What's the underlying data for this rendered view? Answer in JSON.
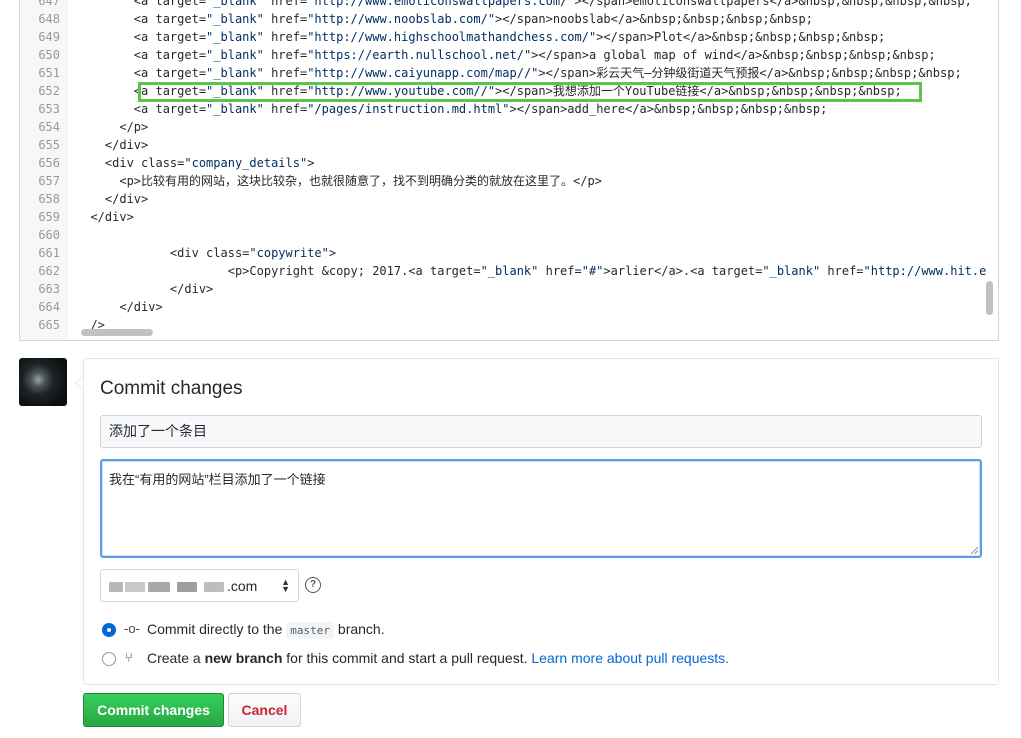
{
  "editor": {
    "lines": [
      {
        "n": "647",
        "parts": [
          {
            "t": "        <a target="
          },
          {
            "t": "\"_blank\"",
            "s": 1
          },
          {
            "t": " href="
          },
          {
            "t": "\"http://www.emoticonswallpapers.com/\"",
            "s": 1
          },
          {
            "t": "></span>emoticonswallpapers</a>&nbsp;&nbsp;&nbsp;&nbsp;"
          }
        ]
      },
      {
        "n": "648",
        "parts": [
          {
            "t": "        <a target="
          },
          {
            "t": "\"_blank\"",
            "s": 1
          },
          {
            "t": " href="
          },
          {
            "t": "\"http://www.noobslab.com/\"",
            "s": 1
          },
          {
            "t": "></span>noobslab</a>&nbsp;&nbsp;&nbsp;&nbsp;"
          }
        ]
      },
      {
        "n": "649",
        "parts": [
          {
            "t": "        <a target="
          },
          {
            "t": "\"_blank\"",
            "s": 1
          },
          {
            "t": " href="
          },
          {
            "t": "\"http://www.highschoolmathandchess.com/\"",
            "s": 1
          },
          {
            "t": "></span>Plot</a>&nbsp;&nbsp;&nbsp;&nbsp;"
          }
        ]
      },
      {
        "n": "650",
        "parts": [
          {
            "t": "        <a target="
          },
          {
            "t": "\"_blank\"",
            "s": 1
          },
          {
            "t": " href="
          },
          {
            "t": "\"https://earth.nullschool.net/\"",
            "s": 1
          },
          {
            "t": "></span>a global map of wind</a>&nbsp;&nbsp;&nbsp;&nbsp;"
          }
        ]
      },
      {
        "n": "651",
        "parts": [
          {
            "t": "        <a target="
          },
          {
            "t": "\"_blank\"",
            "s": 1
          },
          {
            "t": " href="
          },
          {
            "t": "\"http://www.caiyunapp.com/map//\"",
            "s": 1
          },
          {
            "t": "></span>彩云天气—分钟级街道天气预报</a>&nbsp;&nbsp;&nbsp;&nbsp;"
          }
        ]
      },
      {
        "n": "652",
        "parts": [
          {
            "t": "        <a target="
          },
          {
            "t": "\"_blank\"",
            "s": 1
          },
          {
            "t": " href="
          },
          {
            "t": "\"http://www.youtube.com//\"",
            "s": 1
          },
          {
            "t": "></span>我想添加一个YouTube链接</a>&nbsp;&nbsp;&nbsp;&nbsp;"
          }
        ]
      },
      {
        "n": "653",
        "parts": [
          {
            "t": "        <a target="
          },
          {
            "t": "\"_blank\"",
            "s": 1
          },
          {
            "t": " href="
          },
          {
            "t": "\"/pages/instruction.md.html\"",
            "s": 1
          },
          {
            "t": "></span>add_here</a>&nbsp;&nbsp;&nbsp;&nbsp;"
          }
        ]
      },
      {
        "n": "654",
        "parts": [
          {
            "t": "      </p>"
          }
        ]
      },
      {
        "n": "655",
        "parts": [
          {
            "t": "    </div>"
          }
        ]
      },
      {
        "n": "656",
        "parts": [
          {
            "t": "    <div class="
          },
          {
            "t": "\"company_details\"",
            "s": 1
          },
          {
            "t": ">"
          }
        ]
      },
      {
        "n": "657",
        "parts": [
          {
            "t": "      <p>比较有用的网站，这块比较杂，也就很随意了，找不到明确分类的就放在这里了。</p>"
          }
        ]
      },
      {
        "n": "658",
        "parts": [
          {
            "t": "    </div>"
          }
        ]
      },
      {
        "n": "659",
        "parts": [
          {
            "t": "  </div>"
          }
        ]
      },
      {
        "n": "660",
        "parts": [
          {
            "t": ""
          }
        ]
      },
      {
        "n": "661",
        "parts": [
          {
            "t": "             <div class="
          },
          {
            "t": "\"copywrite\"",
            "s": 1
          },
          {
            "t": ">"
          }
        ]
      },
      {
        "n": "662",
        "parts": [
          {
            "t": "                     <p>Copyright &copy; 2017.<a target="
          },
          {
            "t": "\"_blank\"",
            "s": 1
          },
          {
            "t": " href="
          },
          {
            "t": "\"#\"",
            "s": 1
          },
          {
            "t": ">arlier</a>.<a target="
          },
          {
            "t": "\"_blank\"",
            "s": 1
          },
          {
            "t": " href="
          },
          {
            "t": "\"http://www.hit.e",
            "s": 1
          }
        ]
      },
      {
        "n": "663",
        "parts": [
          {
            "t": "             </div>"
          }
        ]
      },
      {
        "n": "664",
        "parts": [
          {
            "t": "      </div>"
          }
        ]
      },
      {
        "n": "665",
        "parts": [
          {
            "t": "  />"
          }
        ]
      }
    ]
  },
  "commit": {
    "title": "Commit changes",
    "summary_value": "添加了一个条目",
    "description_value": "我在“有用的网站”栏目添加了一个链接",
    "email_domain": ".com",
    "help_glyph": "?",
    "option_direct_prefix": "Commit directly to the ",
    "branch_name": "master",
    "option_direct_suffix": " branch.",
    "option_new_prefix": "Create a ",
    "option_new_bold": "new branch",
    "option_new_middle": " for this commit and start a pull request. ",
    "option_new_link": "Learn more about pull requests.",
    "commit_button": "Commit changes",
    "cancel_button": "Cancel"
  },
  "icons": {
    "commit": "git-commit-icon",
    "pull_request": "git-pull-request-icon",
    "help": "question-icon",
    "select": "select-arrows-icon"
  },
  "colors": {
    "highlight_box": "#5bc547",
    "commit_button": "#28a745",
    "cancel_text": "#cb2431",
    "link": "#0366d6",
    "code_string": "#032f62"
  }
}
